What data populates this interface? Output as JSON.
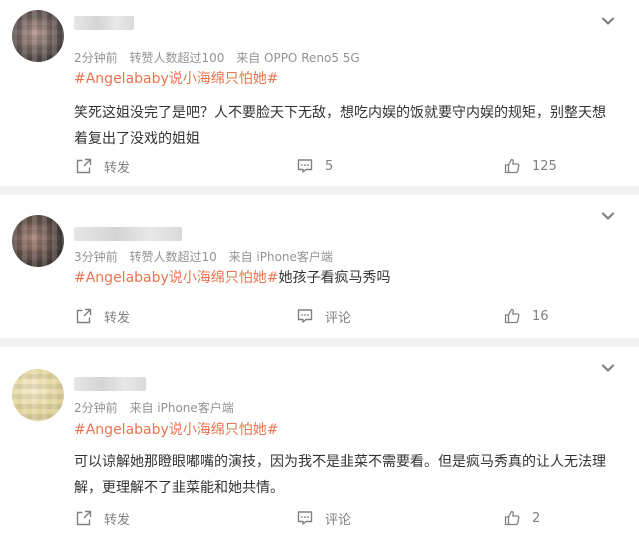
{
  "actions": {
    "repost_label": "转发",
    "comment_label": "评论"
  },
  "comments": [
    {
      "meta": {
        "time": "2分钟前",
        "likes_info": "转赞人数超过100",
        "source": "来自 OPPO Reno5 5G"
      },
      "hashtag": "#Angelababy说小海绵只怕她#",
      "text": "笑死这姐没完了是吧？人不要脸天下无敌，想吃内娱的饭就要守内娱的规矩，别整天想着复出了没戏的姐姐",
      "comment_count": "5",
      "like_count": "125"
    },
    {
      "meta": {
        "time": "3分钟前",
        "likes_info": "转赞人数超过10",
        "source": "来自 iPhone客户端"
      },
      "hashtag": "#Angelababy说小海绵只怕她#",
      "text": "她孩子看疯马秀吗",
      "comment_count": "评论",
      "like_count": "16"
    },
    {
      "meta": {
        "time": "2分钟前",
        "likes_info": "",
        "source": "来自 iPhone客户端"
      },
      "hashtag": "#Angelababy说小海绵只怕她#",
      "text": "可以谅解她那瞪眼嘟嘴的演技，因为我不是韭菜不需要看。但是疯马秀真的让人无法理解，更理解不了韭菜能和她共情。",
      "comment_count": "评论",
      "like_count": "2"
    }
  ]
}
